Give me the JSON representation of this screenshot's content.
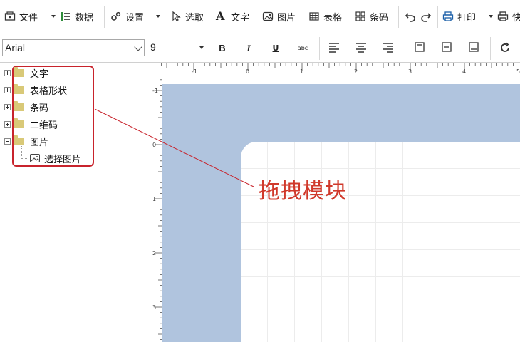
{
  "toolbar": {
    "file_label": "文件",
    "data_label": "数据",
    "settings_label": "设置",
    "select_label": "选取",
    "text_label": "文字",
    "image_label": "图片",
    "table_label": "表格",
    "barcode_label": "条码",
    "print_label": "打印",
    "quick_label": "快"
  },
  "format_bar": {
    "font_family": "Arial",
    "font_size": "9",
    "bold": "B",
    "italic": "I",
    "underline": "U",
    "strike": "abc"
  },
  "tree": {
    "items": [
      {
        "label": "文字"
      },
      {
        "label": "表格形状"
      },
      {
        "label": "条码"
      },
      {
        "label": "二维码"
      },
      {
        "label": "图片"
      }
    ],
    "child_label": "选择图片"
  },
  "ruler": {
    "h_labels": [
      "-1",
      "0",
      "1",
      "2",
      "3",
      "4",
      "5"
    ],
    "v_labels": [
      "-1",
      "0",
      "1",
      "2",
      "3"
    ]
  },
  "annotation": {
    "text": "拖拽模块",
    "color": "#d0392b"
  },
  "colors": {
    "canvas_bg": "#b0c4de",
    "highlight": "#c8232c"
  }
}
